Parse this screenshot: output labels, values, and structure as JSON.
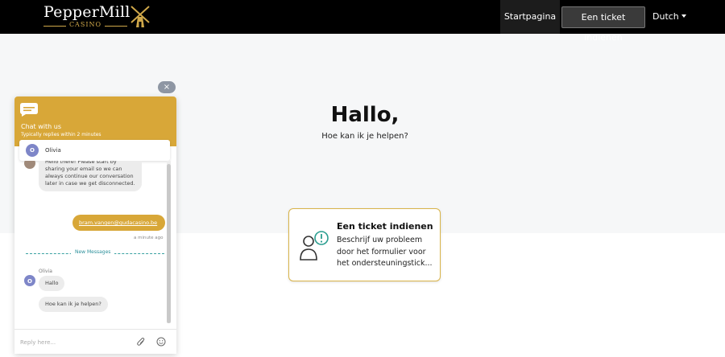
{
  "brand": {
    "name": "PepperMill",
    "sub": "CASINO",
    "accent": "#d8a738"
  },
  "nav": {
    "home": "Startpagina",
    "submit_ticket": "Een ticket indienen",
    "language": "Dutch"
  },
  "hero": {
    "title": "Hallo,",
    "subtitle": "Hoe kan ik je helpen?"
  },
  "card": {
    "title": "Een ticket indienen",
    "description": "Beschrijf uw probleem door het formulier voor het ondersteuningstick..."
  },
  "chat": {
    "close": "×",
    "title": "Chat with us",
    "reply_time": "Typically replies within 2 minutes",
    "agent_initial": "O",
    "agent_name": "Olivia",
    "messages": [
      {
        "text": "Hello there! Please start by sharing your email so we can always continue our conversation later in case we get disconnected."
      },
      {
        "text": "bram.vangen@gudacasino.be",
        "time": "a minute ago"
      },
      {
        "text": "Hallo"
      },
      {
        "text": "Hoe kan ik je helpen?"
      }
    ],
    "new_messages": "New Messages",
    "reply_placeholder": "Reply here...",
    "icons": [
      "chat-bubble-icon",
      "attach-icon",
      "emoji-icon"
    ]
  }
}
